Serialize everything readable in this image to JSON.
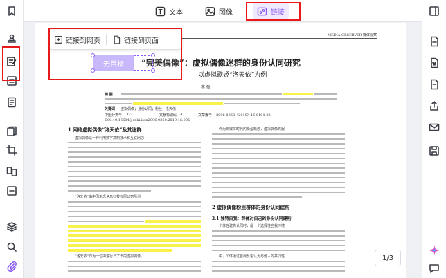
{
  "toolbar": {
    "tabs": [
      {
        "label": "文本",
        "icon": "text-icon"
      },
      {
        "label": "图像",
        "icon": "image-icon"
      },
      {
        "label": "链接",
        "icon": "link-icon"
      }
    ]
  },
  "link_popup": {
    "web_label": "链接到网页",
    "page_label": "链接到页面"
  },
  "link_target_label": "无目标",
  "document": {
    "header_right": "MEDIA OBSERVER 媒体观察",
    "title_quote": "“完美偶像”",
    "title_main": "：虚拟偶像迷群的身份认同研究",
    "subtitle": "——以虚拟歌姬“洛天依”为例",
    "author": "蔡 盈",
    "abstract_label": "摘 要",
    "keywords_label": "关键词",
    "keywords": "虚拟偶像；身份认同；粉丝；洛天依",
    "clc_label": "中图分类号",
    "clc": "G2",
    "doc_code_label": "文献标识码",
    "doc_code": "A",
    "article_no_label": "文章编号",
    "article_no": "2096-0360（2019）16-0101-03",
    "doi": "DOI:10.16604/j.cnki.issn2096-0360.2019.16.035",
    "section1": "1 网络虚拟偶像“洛天依”及其迷群",
    "section2": "2 虚拟偶像粉丝群体的身份认同建构",
    "section21": "2.1 独特自我：群体对自己的身份认同建构",
    "para_start1": "虚拟偶像是一种利用数字复制技术和互联网思",
    "para_start2": "“洛天依”由中国禾念信息科技有限公司所创",
    "para_start3": "“洛天依”作为一位由进行日了年的虚拟偶像，",
    "right_start1": "作为新媒体时代的新型概念，虚拟偶像克服",
    "right_start2": "个体在建构认同时，是一个选择性自我环境",
    "right_start3": "中，个体通过自我反思认为与他人的共同性"
  },
  "pager": {
    "text": "1/3"
  }
}
